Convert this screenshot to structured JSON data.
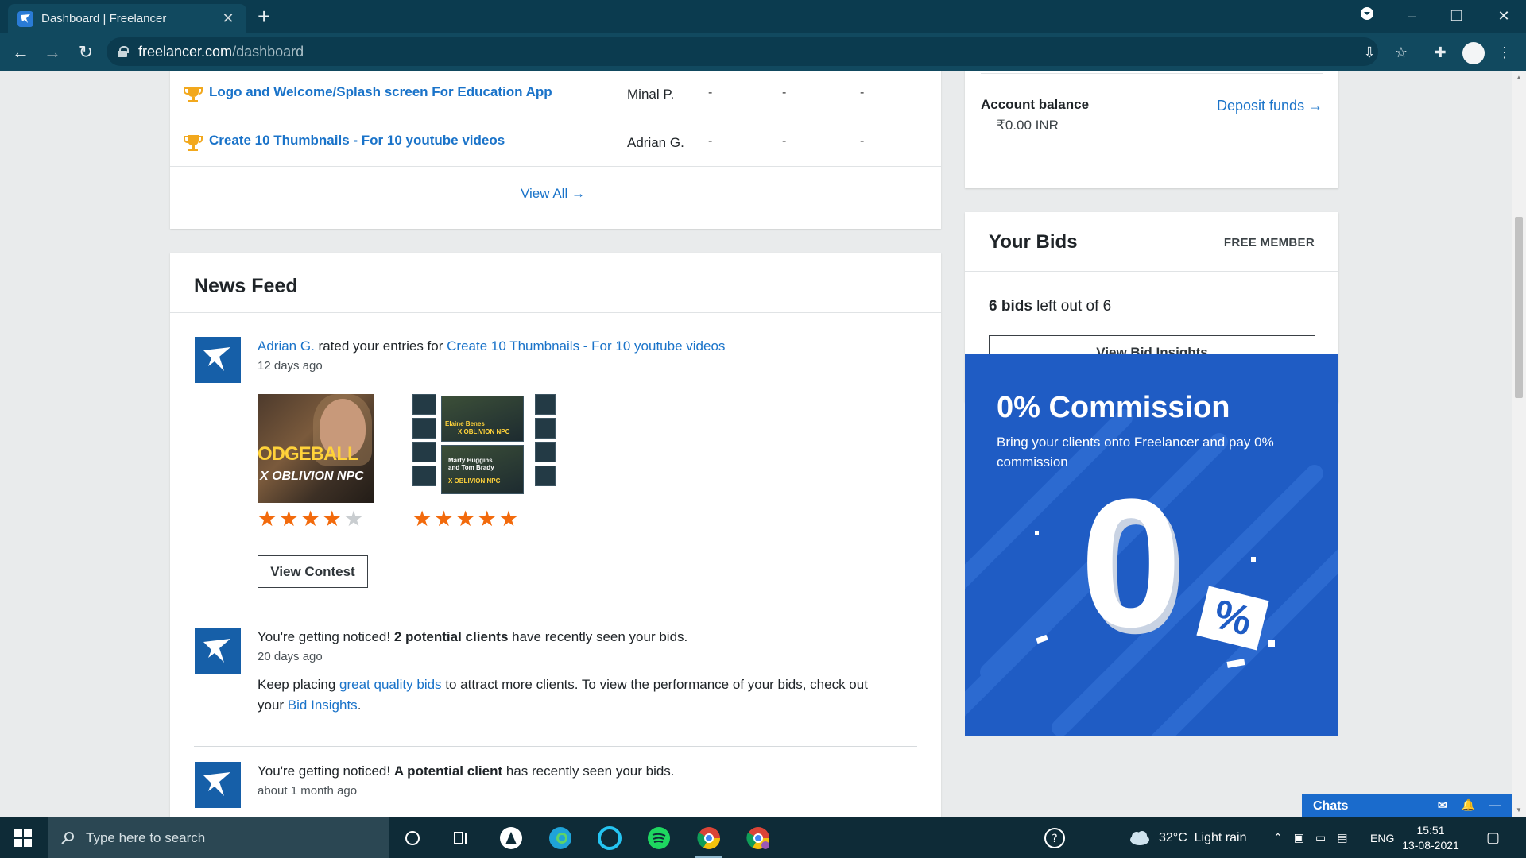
{
  "browser": {
    "tab_title": "Dashboard | Freelancer",
    "url_domain": "freelancer.com",
    "url_path": "/dashboard"
  },
  "contests": {
    "rows": [
      {
        "title": "Logo and Welcome/Splash screen For Education App",
        "owner": "Minal P.",
        "c1": "-",
        "c2": "-",
        "c3": "-"
      },
      {
        "title": "Create 10 Thumbnails - For 10 youtube videos",
        "owner": "Adrian G.",
        "c1": "-",
        "c2": "-",
        "c3": "-"
      }
    ],
    "view_all": "View All →"
  },
  "news_feed": {
    "title": "News Feed",
    "item1": {
      "actor": "Adrian G.",
      "text": " rated your entries for ",
      "contest": "Create 10 Thumbnails - For 10 youtube videos",
      "time": "12 days ago",
      "thumb1_line1": "ODGEBALL",
      "thumb1_line2": "X OBLIVION NPC",
      "thumb2_line1": "Elaine Benes",
      "thumb2_line2": "X OBLIVION NPC",
      "thumb2_line3": "Marty Huggins and Tom Brady",
      "thumb2_line4": "X OBLIVION NPC",
      "rating1": 4,
      "rating2": 5,
      "button": "View Contest"
    },
    "item2": {
      "pre": "You're getting noticed! ",
      "bold": "2 potential clients",
      "post": " have recently seen your bids.",
      "time": "20 days ago",
      "body_pre": "Keep placing ",
      "body_link": "great quality bids",
      "body_mid": " to attract more clients. To view the performance of your bids, check out",
      "body_pre2": "your ",
      "body_link2": "Bid Insights",
      "body_end": "."
    },
    "item3": {
      "pre": "You're getting noticed! ",
      "bold": "A potential client",
      "post": " has recently seen your bids.",
      "time": "about 1 month ago"
    }
  },
  "account": {
    "label": "Account balance",
    "value": "₹0.00 INR",
    "deposit": "Deposit funds →"
  },
  "bids": {
    "title": "Your Bids",
    "badge": "FREE MEMBER",
    "count_bold": "6 bids",
    "count_rest": " left out of 6",
    "button": "View Bid Insights"
  },
  "promo": {
    "title": "0% Commission",
    "subtitle": "Bring your clients onto Freelancer and pay 0% commission",
    "big_zero": "0",
    "percent": "%"
  },
  "chats": {
    "label": "Chats"
  },
  "taskbar": {
    "search_placeholder": "Type here to search",
    "weather": "32°C  Light rain",
    "lang": "ENG",
    "time": "15:51",
    "date": "13-08-2021"
  },
  "colors": {
    "link": "#1a73c9",
    "star": "#f26a0c",
    "promo_bg": "#1f5cc4",
    "chrome": "#0b3b4f"
  }
}
